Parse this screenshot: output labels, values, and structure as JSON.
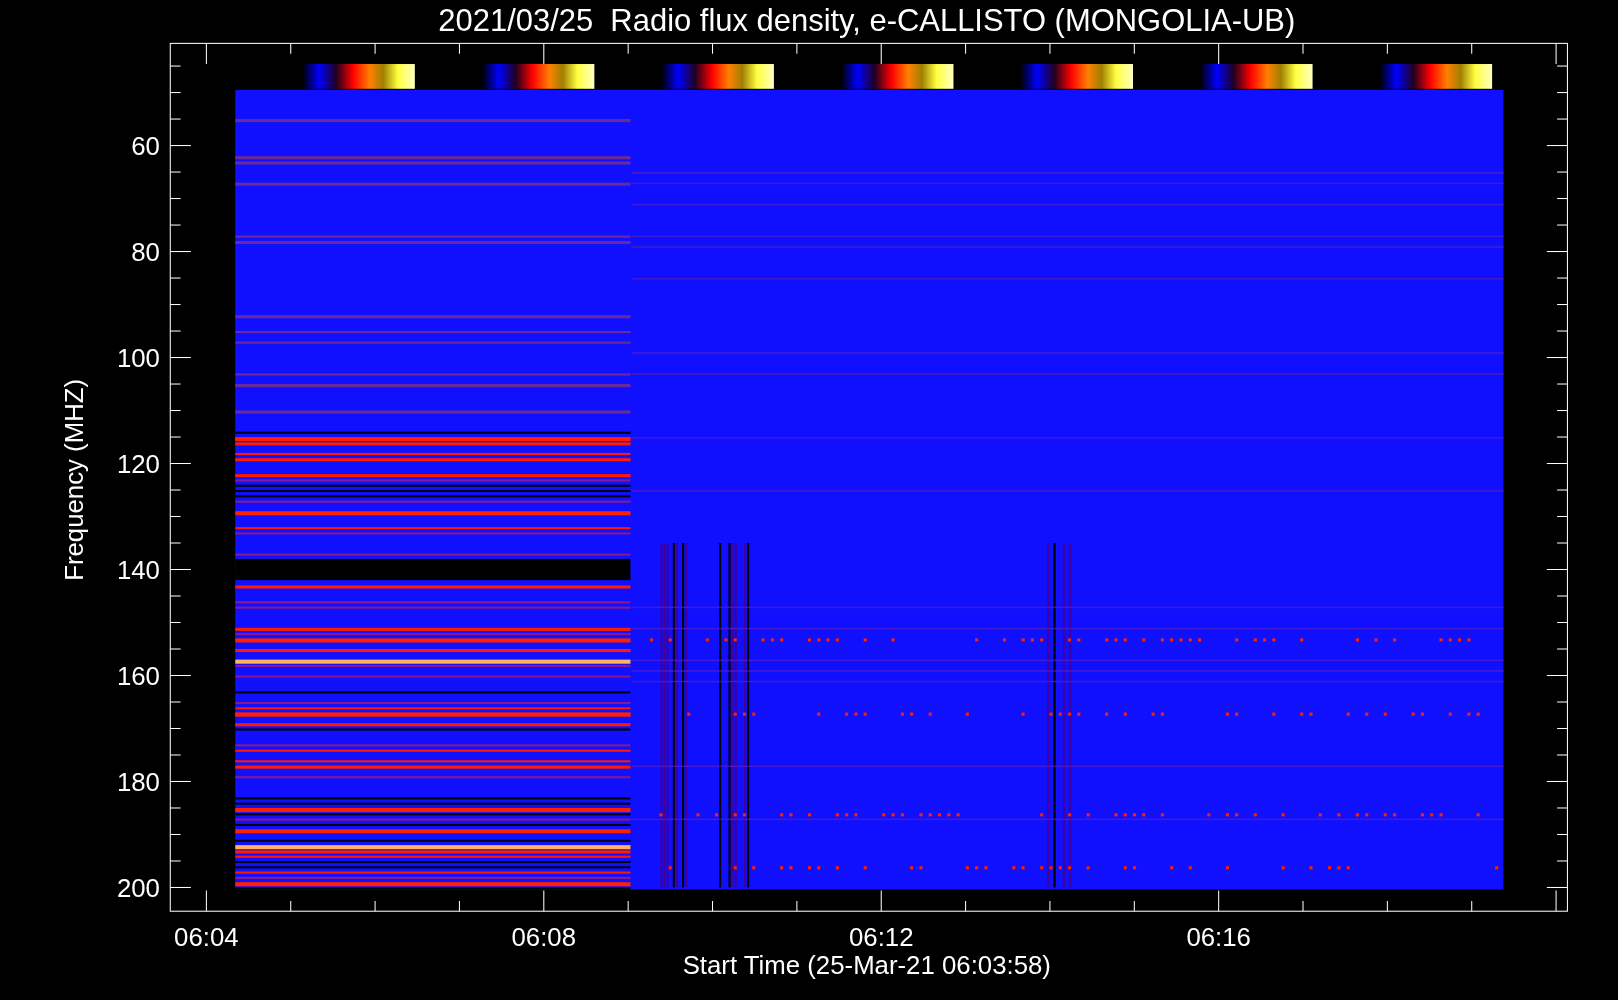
{
  "title": "2021/03/25  Radio flux density, e-CALLISTO (MONGOLIA-UB)",
  "y_axis": {
    "label": "Frequency (MHZ)",
    "ticks": [
      "60",
      "80",
      "100",
      "120",
      "140",
      "160",
      "180",
      "200"
    ]
  },
  "x_axis": {
    "label": "Start Time (25-Mar-21 06:03:58)",
    "ticks": [
      "06:04",
      "06:08",
      "06:12",
      "06:16"
    ]
  }
}
